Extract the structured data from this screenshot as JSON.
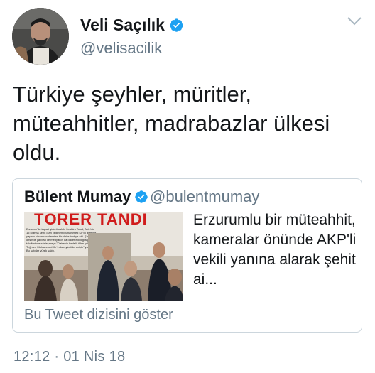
{
  "author": {
    "display_name": "Veli Saçılık",
    "username": "@velisacilik",
    "verified_icon": "verified-badge-icon",
    "avatar_icon": "profile-photo"
  },
  "menu_icon": "chevron-down-icon",
  "tweet": {
    "text": "Türkiye şeyhler, müritler, müteahhitler, madrabazlar ülkesi oldu.",
    "timestamp": "12:12 · 01 Nis 18"
  },
  "quoted_tweet": {
    "display_name": "Bülent Mumay",
    "username": "@bulentmumay",
    "text": "Erzurumlu bir müteahhit, kameralar önünde AKP'li vekili yanına alarak şehit ai...",
    "thread_link": "Bu Tweet dizisini göster",
    "image": {
      "headline": "TÖRER TANDI",
      "caption": "Erzurum'da inşaat şirketi sahibi İbrahim Topal, Afrin'de 15 Mart'ta şehit olan Teğmen Muhammed Kır'ın ailesine yapımı süren rezidanstan bir daire hediye etti. Şirketin ofisinde yapılan ve medyanın da davet edildiği tapu takdiminde sözleşmeye \"Dairenin bedeli, Afrin şehidimiz Teğmen Muhammed Kır'ın kanıyla ödenmiştir\" yazıldı. Bu satırlar yürek yaktı."
    }
  },
  "colors": {
    "text_primary": "#14171a",
    "text_secondary": "#657786",
    "verified_blue": "#1da1f2",
    "border": "#ccd6dd",
    "headline_red": "#d01c1c"
  }
}
